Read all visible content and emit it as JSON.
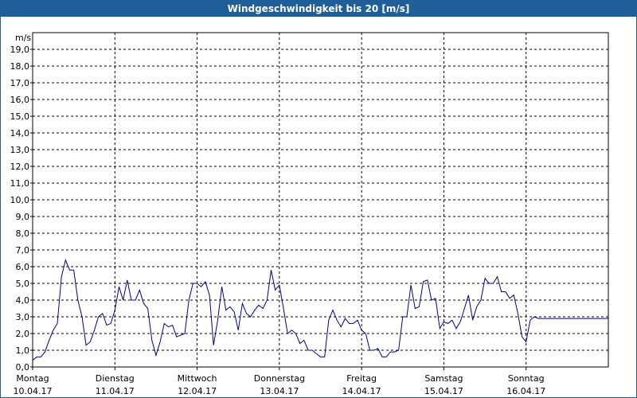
{
  "window": {
    "title": "Windgeschwindigkeit bis 20 [m/s]",
    "title_bg": "#1f5f99"
  },
  "chart_data": {
    "type": "line",
    "title": "Windgeschwindigkeit bis 20 [m/s]",
    "ylabel": "m/s",
    "xlabel": "",
    "ylim": [
      0,
      20
    ],
    "yticks": [
      "0,0",
      "1,0",
      "2,0",
      "3,0",
      "4,0",
      "5,0",
      "6,0",
      "7,0",
      "8,0",
      "9,0",
      "10,0",
      "11,0",
      "12,0",
      "13,0",
      "14,0",
      "15,0",
      "16,0",
      "17,0",
      "18,0",
      "19,0"
    ],
    "days": [
      {
        "weekday": "Montag",
        "date": "10.04.17"
      },
      {
        "weekday": "Dienstag",
        "date": "11.04.17"
      },
      {
        "weekday": "Mittwoch",
        "date": "12.04.17"
      },
      {
        "weekday": "Donnerstag",
        "date": "13.04.17"
      },
      {
        "weekday": "Freitag",
        "date": "14.04.17"
      },
      {
        "weekday": "Samstag",
        "date": "15.04.17"
      },
      {
        "weekday": "Sonntag",
        "date": "16.04.17"
      }
    ],
    "grid": true,
    "line_color": "#00008b",
    "series": [
      {
        "x_days": [
          0,
          0.05,
          0.1,
          0.15,
          0.2,
          0.25,
          0.3,
          0.35,
          0.4,
          0.45,
          0.5,
          0.55,
          0.6,
          0.65,
          0.7,
          0.75,
          0.8,
          0.85,
          0.9,
          0.95,
          1.0,
          1.05,
          1.1,
          1.15,
          1.2,
          1.25,
          1.3,
          1.35,
          1.4,
          1.45,
          1.5,
          1.55,
          1.6,
          1.65,
          1.7,
          1.75,
          1.8,
          1.85,
          1.9,
          1.95,
          2.0,
          2.05,
          2.1,
          2.15,
          2.2,
          2.25,
          2.3,
          2.35,
          2.4,
          2.45,
          2.5,
          2.55,
          2.6,
          2.65,
          2.7,
          2.75,
          2.8,
          2.85,
          2.9,
          2.95,
          3.0,
          3.05,
          3.1,
          3.15,
          3.2,
          3.25,
          3.3,
          3.35,
          3.4,
          3.45,
          3.5,
          3.55,
          3.6,
          3.65,
          3.7,
          3.75,
          3.8,
          3.85,
          3.9,
          3.95,
          4.0,
          4.05,
          4.1,
          4.15,
          4.2,
          4.25,
          4.3,
          4.35,
          4.4,
          4.45,
          4.5,
          4.55,
          4.6,
          4.65,
          4.7,
          4.75,
          4.8,
          4.85,
          4.9,
          4.95,
          5.0,
          5.05,
          5.1,
          5.15,
          5.2,
          5.25,
          5.3,
          5.35,
          5.4,
          5.45,
          5.5,
          5.55,
          5.6,
          5.65,
          5.7,
          5.75,
          5.8,
          5.85,
          5.9,
          5.95,
          6.0,
          6.05,
          6.1,
          6.15,
          6.2,
          6.25,
          6.3,
          6.35,
          6.4,
          6.45,
          6.5,
          6.55,
          6.6,
          6.65,
          6.7,
          6.75,
          6.8,
          6.85,
          6.9,
          6.95,
          7.0
        ],
        "values": [
          0.4,
          0.6,
          0.6,
          0.9,
          1.6,
          2.2,
          2.6,
          5.4,
          6.4,
          5.8,
          5.8,
          4.0,
          3.0,
          1.3,
          1.5,
          2.2,
          3.0,
          3.2,
          2.5,
          2.6,
          3.4,
          4.8,
          4.0,
          5.2,
          4.0,
          4.0,
          4.6,
          3.8,
          3.5,
          1.6,
          0.7,
          1.5,
          2.6,
          2.4,
          2.5,
          1.8,
          1.9,
          2.0,
          4.0,
          5.0,
          5.0,
          4.8,
          5.1,
          4.3,
          1.3,
          2.8,
          4.8,
          3.4,
          3.6,
          3.3,
          2.2,
          3.8,
          3.2,
          3.0,
          3.4,
          3.7,
          3.5,
          4.0,
          5.8,
          4.6,
          4.9,
          3.5,
          2.0,
          2.2,
          2.0,
          1.4,
          1.6,
          1.0,
          1.0,
          0.8,
          0.6,
          0.6,
          2.8,
          3.4,
          2.8,
          2.4,
          2.9,
          2.6,
          2.6,
          2.8,
          2.2,
          2.0,
          1.0,
          1.0,
          1.1,
          0.6,
          0.6,
          0.9,
          0.9,
          1.0,
          3.0,
          3.0,
          4.9,
          3.5,
          3.6,
          5.1,
          5.2,
          4.0,
          4.1,
          2.3,
          2.7,
          2.6,
          2.8,
          2.3,
          2.7,
          3.5,
          4.3,
          2.8,
          3.6,
          4.0,
          5.3,
          5.0,
          5.0,
          5.4,
          4.5,
          4.5,
          4.1,
          4.3,
          3.2,
          1.8,
          1.5,
          2.8,
          3.0,
          2.9,
          2.9,
          2.9,
          2.9,
          2.9,
          2.9,
          2.9,
          2.9,
          2.9,
          2.9,
          2.9,
          2.9,
          2.9,
          2.9,
          2.9,
          2.9,
          2.9,
          2.9
        ]
      }
    ]
  }
}
